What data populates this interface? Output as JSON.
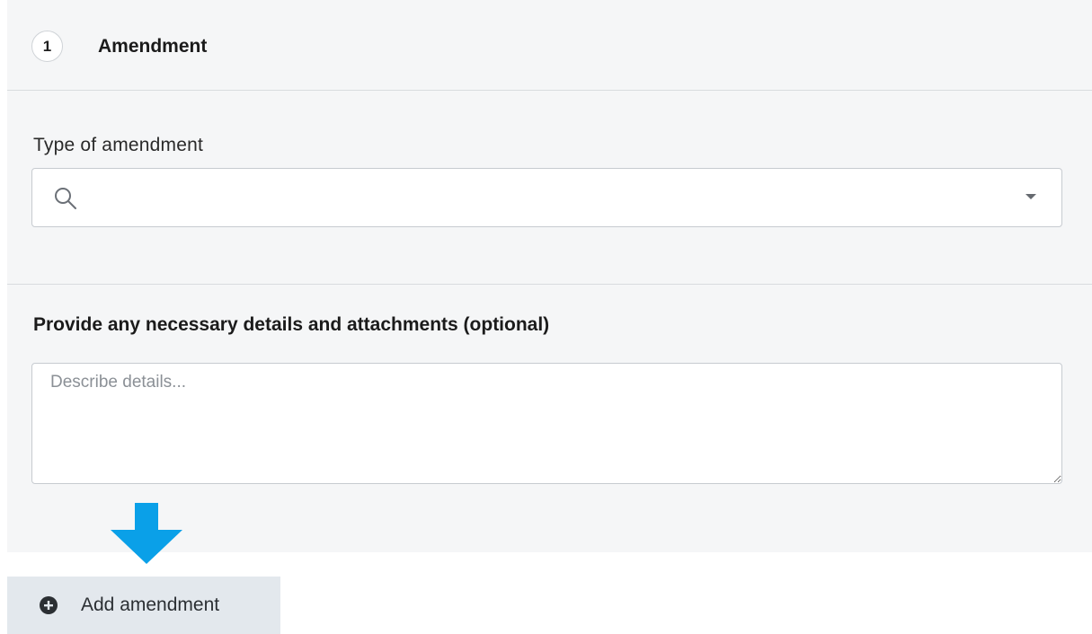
{
  "section": {
    "step_number": "1",
    "title": "Amendment"
  },
  "type_field": {
    "label": "Type of amendment",
    "value": "",
    "search_icon": "search-icon",
    "dropdown_icon": "caret-down-icon"
  },
  "details": {
    "label": "Provide any necessary details and attachments (optional)",
    "placeholder": "Describe details...",
    "value": ""
  },
  "add_button": {
    "label": "Add amendment",
    "icon": "plus-circle-icon"
  },
  "annotation": {
    "icon": "arrow-down-icon",
    "color": "#0aa0e8"
  },
  "colors": {
    "panel_bg": "#f5f6f7",
    "button_bg": "#e3e8ed"
  }
}
